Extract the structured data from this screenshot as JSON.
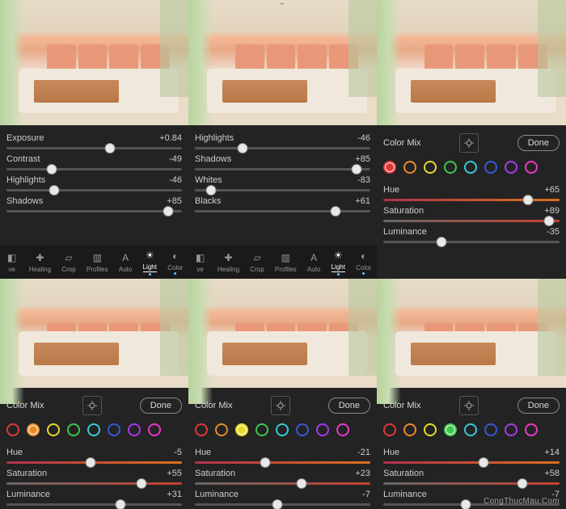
{
  "watermark": "CongThucMau.Com",
  "done_label": "Done",
  "color_mix_label": "Color Mix",
  "labels": {
    "exposure": "Exposure",
    "contrast": "Contrast",
    "highlights": "Highlights",
    "shadows": "Shadows",
    "whites": "Whites",
    "blacks": "Blacks",
    "hue": "Hue",
    "saturation": "Saturation",
    "luminance": "Luminance"
  },
  "tools": [
    {
      "id": "ve",
      "label": "ve"
    },
    {
      "id": "healing",
      "label": "Healing"
    },
    {
      "id": "crop",
      "label": "Crop"
    },
    {
      "id": "profiles",
      "label": "Profiles"
    },
    {
      "id": "auto",
      "label": "Auto"
    },
    {
      "id": "light",
      "label": "Light",
      "active": true,
      "dot": true
    },
    {
      "id": "color",
      "label": "Color",
      "dot": true
    }
  ],
  "swatch_colors": [
    "#e03838",
    "#e88a2c",
    "#e8d82c",
    "#3cc84c",
    "#38c8d8",
    "#3858d8",
    "#a838e8",
    "#e838c8"
  ],
  "panels": {
    "p1": [
      {
        "k": "exposure",
        "v": "+0.84",
        "pct": 59
      },
      {
        "k": "contrast",
        "v": "-49",
        "pct": 26
      },
      {
        "k": "highlights",
        "v": "-46",
        "pct": 27
      },
      {
        "k": "shadows",
        "v": "+85",
        "pct": 92
      }
    ],
    "p2": [
      {
        "k": "highlights",
        "v": "-46",
        "pct": 27
      },
      {
        "k": "shadows",
        "v": "+85",
        "pct": 92
      },
      {
        "k": "whites",
        "v": "-83",
        "pct": 9
      },
      {
        "k": "blacks",
        "v": "+61",
        "pct": 80
      }
    ],
    "p3": {
      "selected": 0,
      "rows": [
        {
          "k": "hue",
          "v": "+65",
          "pct": 82,
          "grad": "gradient-red"
        },
        {
          "k": "saturation",
          "v": "+89",
          "pct": 94,
          "grad": "gradient-sat"
        },
        {
          "k": "luminance",
          "v": "-35",
          "pct": 33
        }
      ]
    },
    "p4": {
      "selected": 1,
      "rows": [
        {
          "k": "hue",
          "v": "-5",
          "pct": 48,
          "grad": "gradient-red"
        },
        {
          "k": "saturation",
          "v": "+55",
          "pct": 77,
          "grad": "gradient-sat"
        },
        {
          "k": "luminance",
          "v": "+31",
          "pct": 65
        }
      ]
    },
    "p5": {
      "selected": 2,
      "rows": [
        {
          "k": "hue",
          "v": "-21",
          "pct": 40,
          "grad": "gradient-red"
        },
        {
          "k": "saturation",
          "v": "+23",
          "pct": 61,
          "grad": "gradient-sat"
        },
        {
          "k": "luminance",
          "v": "-7",
          "pct": 47
        }
      ]
    },
    "p6": {
      "selected": 3,
      "rows": [
        {
          "k": "hue",
          "v": "+14",
          "pct": 57,
          "grad": "gradient-red"
        },
        {
          "k": "saturation",
          "v": "+58",
          "pct": 79,
          "grad": "gradient-sat"
        },
        {
          "k": "luminance",
          "v": "-7",
          "pct": 47
        }
      ]
    }
  }
}
